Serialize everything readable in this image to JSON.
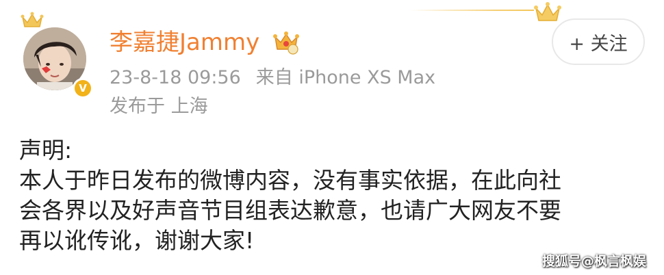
{
  "post": {
    "username": "李嘉捷Jammy",
    "timestamp": "23-8-18 09:56",
    "source": "来自 iPhone XS Max",
    "location": "发布于 上海",
    "follow_label": "+ 关注",
    "body_lines": [
      "声明:",
      "本人于昨日发布的微博内容，没有事实依据，在此向社",
      "会各界以及好声音节目组表达歉意，也请广大网友不要",
      "再以讹传讹，谢谢大家!"
    ]
  },
  "badges": {
    "verified": "V"
  },
  "watermark": "搜狐号@枫言枫娱",
  "colors": {
    "username": "#f08031",
    "meta": "#9a9a9a",
    "body_text": "#222222",
    "verified_badge": "#f2b21a",
    "crown_gold": "#f3c65a"
  },
  "icons": {
    "avatar": "user-avatar-photo",
    "verified": "verified-v-icon",
    "vip": "vip-crown-icon",
    "decoration": "gold-crown-icon"
  }
}
